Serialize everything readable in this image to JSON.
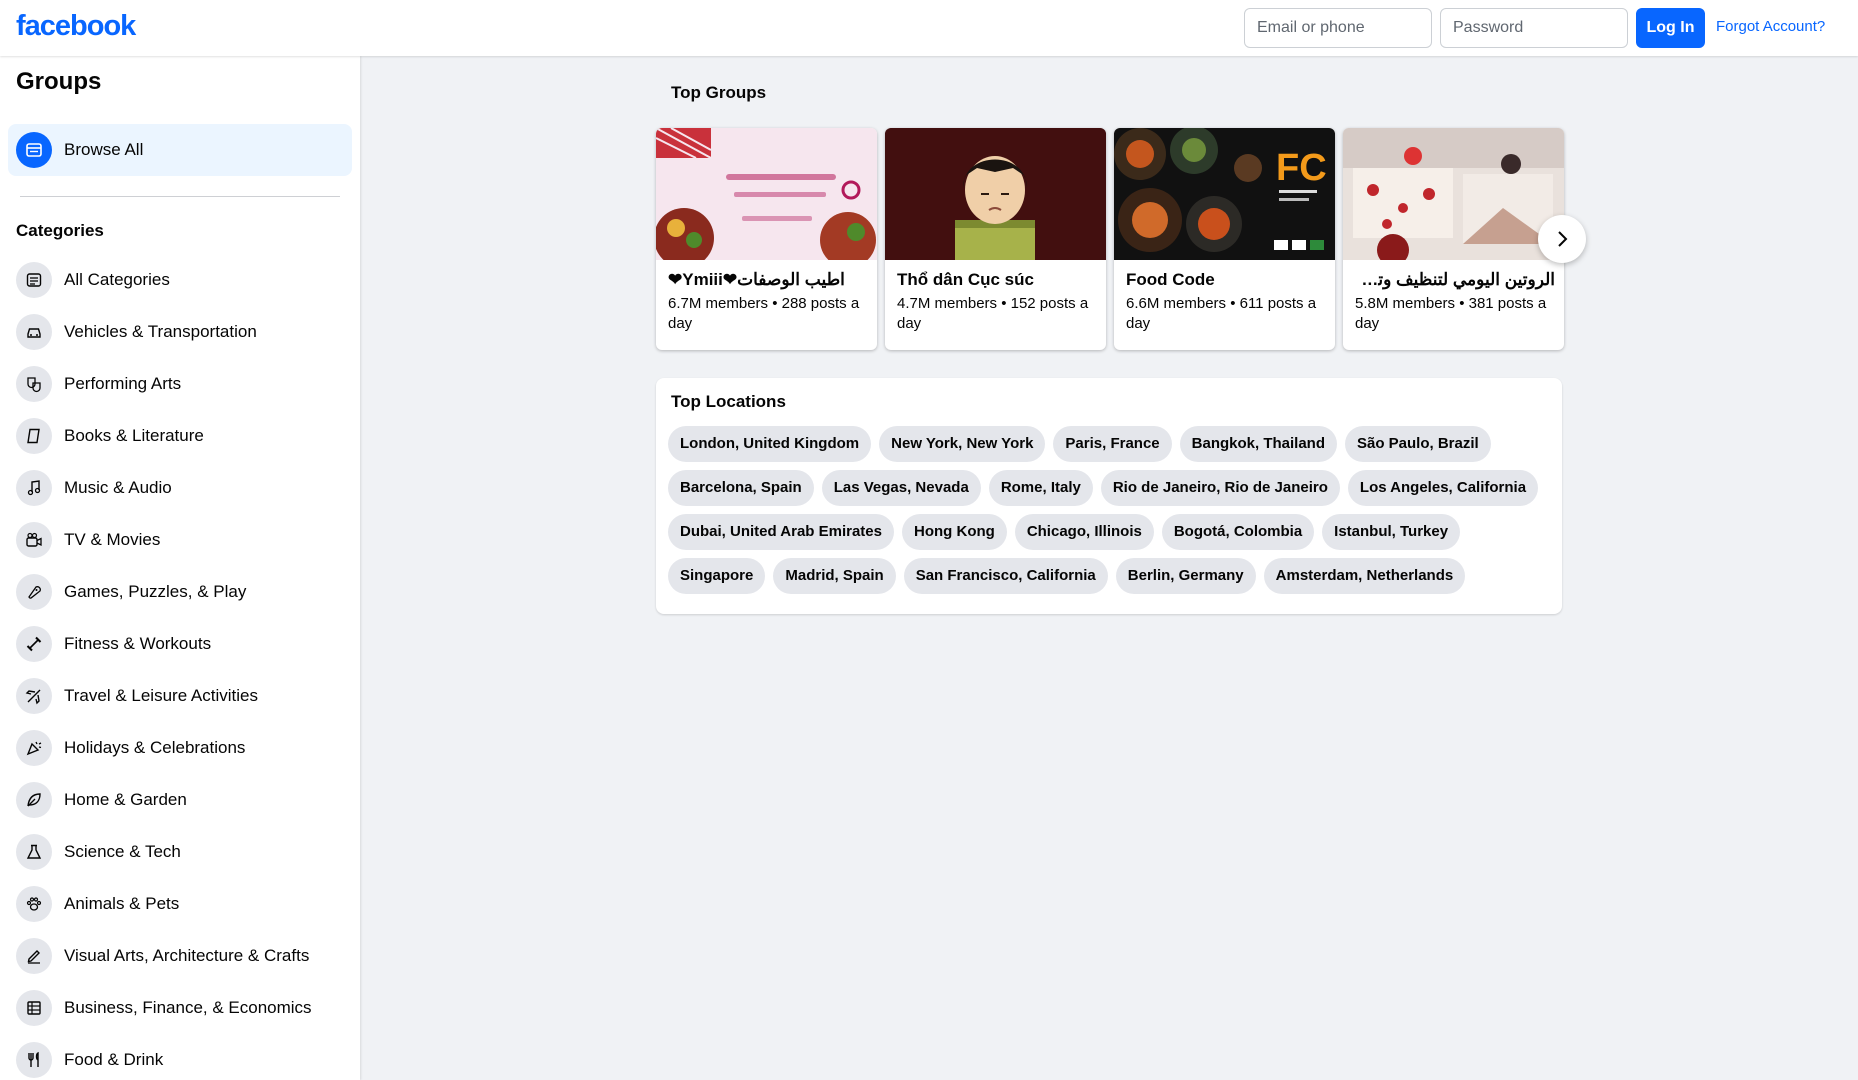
{
  "header": {
    "logo": "facebook",
    "email_placeholder": "Email or phone",
    "password_placeholder": "Password",
    "login_label": "Log In",
    "forgot_label": "Forgot Account?"
  },
  "sidebar": {
    "title": "Groups",
    "browse_all": "Browse All",
    "categories_heading": "Categories",
    "categories": [
      {
        "label": "All Categories",
        "icon": "grid-list-icon"
      },
      {
        "label": "Vehicles & Transportation",
        "icon": "car-icon"
      },
      {
        "label": "Performing Arts",
        "icon": "theater-masks-icon"
      },
      {
        "label": "Books & Literature",
        "icon": "book-icon"
      },
      {
        "label": "Music & Audio",
        "icon": "music-note-icon"
      },
      {
        "label": "TV & Movies",
        "icon": "video-camera-icon"
      },
      {
        "label": "Games, Puzzles, & Play",
        "icon": "game-controller-icon"
      },
      {
        "label": "Fitness & Workouts",
        "icon": "dumbbell-icon"
      },
      {
        "label": "Travel & Leisure Activities",
        "icon": "airplane-icon"
      },
      {
        "label": "Holidays & Celebrations",
        "icon": "party-popper-icon"
      },
      {
        "label": "Home & Garden",
        "icon": "leaf-icon"
      },
      {
        "label": "Science & Tech",
        "icon": "flask-icon"
      },
      {
        "label": "Animals & Pets",
        "icon": "paw-icon"
      },
      {
        "label": "Visual Arts, Architecture & Crafts",
        "icon": "pen-icon"
      },
      {
        "label": "Business, Finance, & Economics",
        "icon": "ledger-icon"
      },
      {
        "label": "Food & Drink",
        "icon": "fork-knife-icon"
      }
    ]
  },
  "top_groups": {
    "title": "Top Groups",
    "groups": [
      {
        "name": "❤Ymiii❤اطيب الوصفات",
        "meta": "6.7M members • 288 posts a day",
        "image": "food-recipes-banner"
      },
      {
        "name": "Thổ dân Cục súc",
        "meta": "4.7M members • 152 posts a day",
        "image": "anime-character"
      },
      {
        "name": "Food Code",
        "meta": "6.6M members • 611 posts a day",
        "image": "food-code-dishes"
      },
      {
        "name": "الروتين اليومي لتنظيف وترتيب",
        "meta": "5.8M members • 381 posts a day",
        "image": "bedroom-decor"
      }
    ],
    "next_icon": "chevron-right-icon"
  },
  "top_locations": {
    "title": "Top Locations",
    "rows": [
      [
        "London, United Kingdom",
        "New York, New York",
        "Paris, France",
        "Bangkok, Thailand",
        "São Paulo, Brazil"
      ],
      [
        "Barcelona, Spain",
        "Las Vegas, Nevada",
        "Rome, Italy",
        "Rio de Janeiro, Rio de Janeiro",
        "Los Angeles, California"
      ],
      [
        "Dubai, United Arab Emirates",
        "Hong Kong",
        "Chicago, Illinois",
        "Bogotá, Colombia",
        "Istanbul, Turkey"
      ],
      [
        "Singapore",
        "Madrid, Spain",
        "San Francisco, California",
        "Berlin, Germany",
        "Amsterdam, Netherlands"
      ]
    ]
  },
  "colors": {
    "brand": "#0866ff",
    "background": "#f0f2f5",
    "chip": "#e4e6eb",
    "selected_bg": "#ebf5ff"
  }
}
